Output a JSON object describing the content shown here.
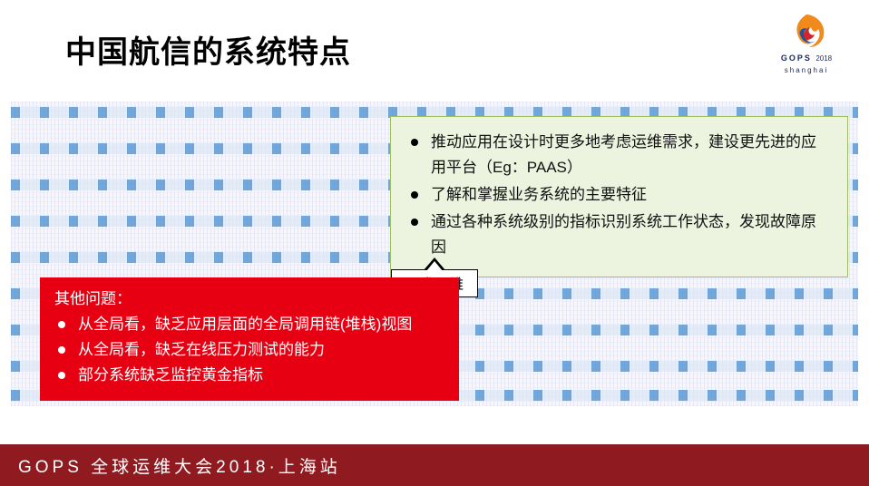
{
  "title": "中国航信的系统特点",
  "logo": {
    "brand": "GOPS",
    "year": "2018",
    "sub": "shanghai"
  },
  "tag": "要求运维",
  "green": {
    "items": [
      "推动应用在设计时更多地考虑运维需求，建设更先进的应用平台（Eg：PAAS）",
      "了解和掌握业务系统的主要特征",
      "通过各种系统级别的指标识别系统工作状态，发现故障原因"
    ]
  },
  "red": {
    "header": "其他问题：",
    "items": [
      "从全局看，缺乏应用层面的全局调用链(堆栈)视图",
      "从全局看，缺乏在线压力测试的能力",
      "部分系统缺乏监控黄金指标"
    ]
  },
  "footer": "GOPS 全球运维大会2018·上海站",
  "colors": {
    "red": "#e60012",
    "green": "#ecf3de",
    "footer": "#8f1b21"
  }
}
